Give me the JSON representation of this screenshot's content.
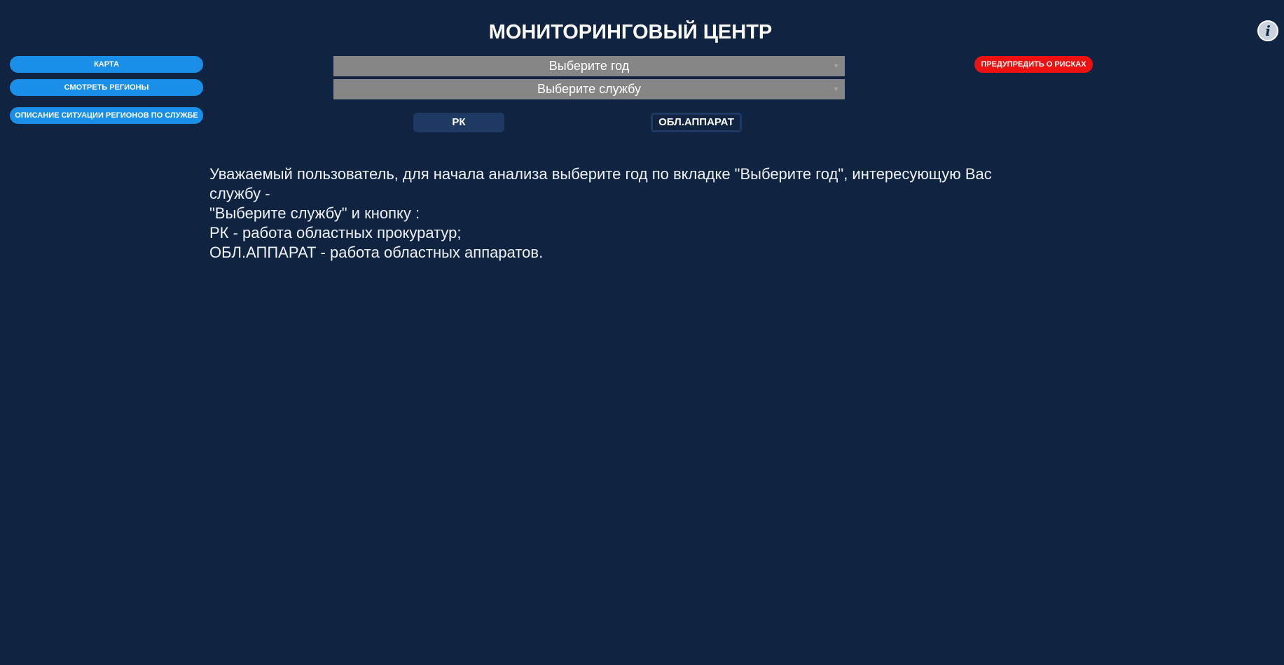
{
  "header": {
    "title": "МОНИТОРИНГОВЫЙ ЦЕНТР",
    "info_icon": "i"
  },
  "sidebar": {
    "items": [
      {
        "label": "КАРТА"
      },
      {
        "label": "СМОТРЕТЬ РЕГИОНЫ"
      },
      {
        "label": "ОПИСАНИЕ СИТУАЦИИ РЕГИОНОВ ПО СЛУЖБЕ"
      }
    ]
  },
  "filters": {
    "year_select": {
      "value": "Выберите год"
    },
    "service_select": {
      "value": "Выберите службу"
    }
  },
  "modes": {
    "rk_label": "РК",
    "obl_label": "ОБЛ.АППАРАТ"
  },
  "alert": {
    "risk_label": "ПРЕДУПРЕДИТЬ О РИСКАХ"
  },
  "message": {
    "line1": "Уважаемый пользователь, для начала анализа выберите год по вкладке \"Выберите год\", интересующую Вас службу -",
    "line2": "\"Выберите службу\" и кнопку :",
    "line3": "РК - работа областных прокуратур;",
    "line4": "ОБЛ.АППАРАТ - работа областных аппаратов."
  },
  "colors": {
    "background": "#102442",
    "primary_button": "#1a8fe8",
    "alert_button": "#ee1111",
    "select_bg": "#868686",
    "mode_button": "#1e3a63"
  }
}
